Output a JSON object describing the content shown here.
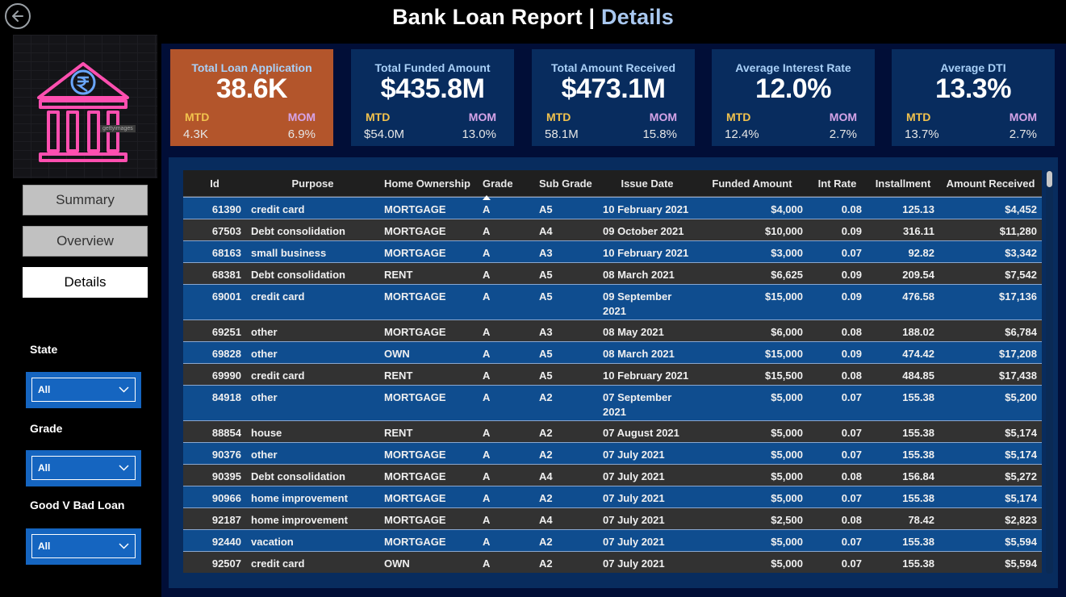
{
  "header": {
    "title_main": "Bank Loan Report | ",
    "title_accent": "Details"
  },
  "nav": {
    "buttons": [
      "Summary",
      "Overview",
      "Details"
    ],
    "active": "Details"
  },
  "logo": {
    "watermark": "gettyimages"
  },
  "filters": [
    {
      "label": "State",
      "value": "All"
    },
    {
      "label": "Grade",
      "value": "All"
    },
    {
      "label": "Good V Bad Loan",
      "value": "All"
    }
  ],
  "kpis": [
    {
      "title": "Total Loan Application",
      "value": "38.6K",
      "mtd_label": "MTD",
      "mom_label": "MOM",
      "mtd": "4.3K",
      "mom": "6.9%"
    },
    {
      "title": "Total Funded Amount",
      "value": "$435.8M",
      "mtd_label": "MTD",
      "mom_label": "MOM",
      "mtd": "$54.0M",
      "mom": "13.0%"
    },
    {
      "title": "Total Amount Received",
      "value": "$473.1M",
      "mtd_label": "MTD",
      "mom_label": "MOM",
      "mtd": "58.1M",
      "mom": "15.8%"
    },
    {
      "title": "Average Interest Rate",
      "value": "12.0%",
      "mtd_label": "MTD",
      "mom_label": "MOM",
      "mtd": "12.4%",
      "mom": "2.7%"
    },
    {
      "title": "Average DTI",
      "value": "13.3%",
      "mtd_label": "MTD",
      "mom_label": "MOM",
      "mtd": "13.7%",
      "mom": "2.7%"
    }
  ],
  "table": {
    "columns": [
      "Id",
      "Purpose",
      "Home Ownership",
      "Grade",
      "Sub Grade",
      "Issue Date",
      "Funded Amount",
      "Int Rate",
      "Installment",
      "Amount Received"
    ],
    "sorted_by": "Grade",
    "rows": [
      [
        "61390",
        "credit card",
        "MORTGAGE",
        "A",
        "A5",
        "10 February 2021",
        "$4,000",
        "0.08",
        "125.13",
        "$4,452"
      ],
      [
        "67503",
        "Debt consolidation",
        "MORTGAGE",
        "A",
        "A4",
        "09 October 2021",
        "$10,000",
        "0.09",
        "316.11",
        "$11,280"
      ],
      [
        "68163",
        "small business",
        "MORTGAGE",
        "A",
        "A3",
        "10 February 2021",
        "$3,000",
        "0.07",
        "92.82",
        "$3,342"
      ],
      [
        "68381",
        "Debt consolidation",
        "RENT",
        "A",
        "A5",
        "08 March 2021",
        "$6,625",
        "0.09",
        "209.54",
        "$7,542"
      ],
      [
        "69001",
        "credit card",
        "MORTGAGE",
        "A",
        "A5",
        "09 September 2021",
        "$15,000",
        "0.09",
        "476.58",
        "$17,136"
      ],
      [
        "69251",
        "other",
        "MORTGAGE",
        "A",
        "A3",
        "08 May 2021",
        "$6,000",
        "0.08",
        "188.02",
        "$6,784"
      ],
      [
        "69828",
        "other",
        "OWN",
        "A",
        "A5",
        "08 March 2021",
        "$15,000",
        "0.09",
        "474.42",
        "$17,208"
      ],
      [
        "69990",
        "credit card",
        "RENT",
        "A",
        "A5",
        "10 February 2021",
        "$15,500",
        "0.08",
        "484.85",
        "$17,438"
      ],
      [
        "84918",
        "other",
        "MORTGAGE",
        "A",
        "A2",
        "07 September 2021",
        "$5,000",
        "0.07",
        "155.38",
        "$5,200"
      ],
      [
        "88854",
        "house",
        "RENT",
        "A",
        "A2",
        "07 August 2021",
        "$5,000",
        "0.07",
        "155.38",
        "$5,174"
      ],
      [
        "90376",
        "other",
        "MORTGAGE",
        "A",
        "A2",
        "07 July 2021",
        "$5,000",
        "0.07",
        "155.38",
        "$5,174"
      ],
      [
        "90395",
        "Debt consolidation",
        "MORTGAGE",
        "A",
        "A4",
        "07 July 2021",
        "$5,000",
        "0.08",
        "156.84",
        "$5,272"
      ],
      [
        "90966",
        "home improvement",
        "MORTGAGE",
        "A",
        "A2",
        "07 July 2021",
        "$5,000",
        "0.07",
        "155.38",
        "$5,174"
      ],
      [
        "92187",
        "home improvement",
        "MORTGAGE",
        "A",
        "A4",
        "07 July 2021",
        "$2,500",
        "0.08",
        "78.42",
        "$2,823"
      ],
      [
        "92440",
        "vacation",
        "MORTGAGE",
        "A",
        "A2",
        "07 July 2021",
        "$5,000",
        "0.07",
        "155.38",
        "$5,594"
      ],
      [
        "92507",
        "credit card",
        "OWN",
        "A",
        "A2",
        "07 July 2021",
        "$5,000",
        "0.07",
        "155.38",
        "$5,594"
      ]
    ]
  }
}
